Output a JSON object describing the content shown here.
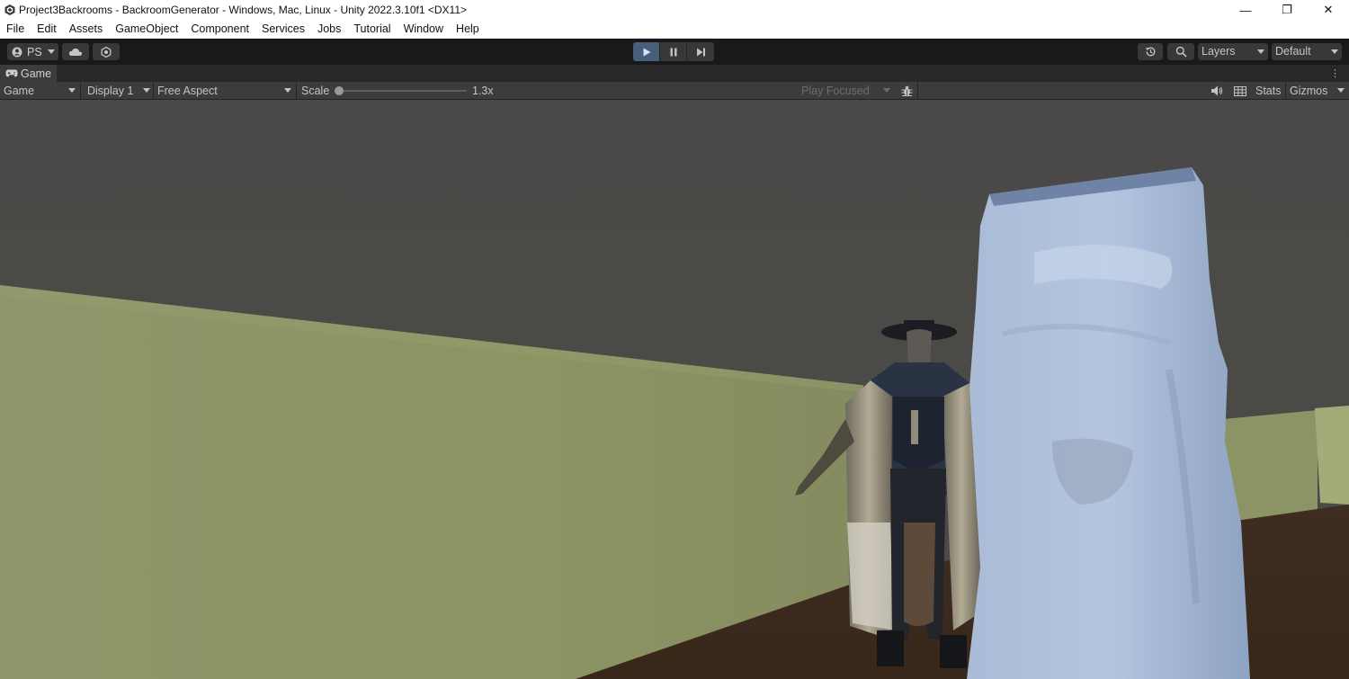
{
  "window": {
    "title": "Project3Backrooms - BackroomGenerator - Windows, Mac, Linux - Unity 2022.3.10f1 <DX11>",
    "controls": {
      "minimize": "—",
      "restore": "❐",
      "close": "✕"
    }
  },
  "menu": [
    "File",
    "Edit",
    "Assets",
    "GameObject",
    "Component",
    "Services",
    "Jobs",
    "Tutorial",
    "Window",
    "Help"
  ],
  "toolbar": {
    "account_label": "PS",
    "layers_label": "Layers",
    "layout_label": "Default"
  },
  "panel": {
    "tab_label": "Game"
  },
  "gamebar": {
    "mode": "Game",
    "display": "Display 1",
    "aspect": "Free Aspect",
    "scale_label": "Scale",
    "scale_value": "1.3x",
    "scale_fraction": 0.05,
    "play_focus": "Play Focused",
    "stats": "Stats",
    "gizmos": "Gizmos"
  },
  "colors": {
    "play_active": "#46607c",
    "editor_dark": "#191919",
    "panel_bg": "#3c3c3c",
    "ceiling": "#4b4a47",
    "wall": "#8f9668",
    "floor": "#3b2a20",
    "sheet_ghost": "#aebfd8"
  },
  "icons": [
    "unity-logo-icon",
    "account-icon",
    "cloud-icon",
    "collab-icon",
    "play-icon",
    "pause-icon",
    "step-icon",
    "history-icon",
    "search-icon",
    "game-controller-icon",
    "kebab-menu-icon",
    "bug-icon",
    "audio-icon",
    "grid-icon"
  ]
}
